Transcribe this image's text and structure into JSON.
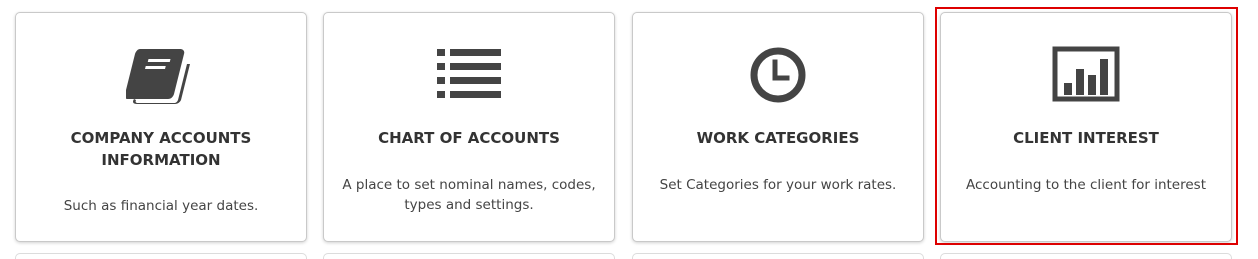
{
  "cards": [
    {
      "icon": "address-book-icon",
      "title": "COMPANY ACCOUNTS INFORMATION",
      "description": "Such as financial year dates."
    },
    {
      "icon": "list-icon",
      "title": "CHART OF ACCOUNTS",
      "description": "A place to set nominal names, codes, types and settings."
    },
    {
      "icon": "clock-icon",
      "title": "WORK CATEGORIES",
      "description": "Set Categories for your work rates."
    },
    {
      "icon": "bar-chart-icon",
      "title": "CLIENT INTEREST",
      "description": "Accounting to the client for interest"
    }
  ],
  "colors": {
    "icon": "#444444",
    "title": "#333333",
    "highlight": "#dd0000"
  }
}
